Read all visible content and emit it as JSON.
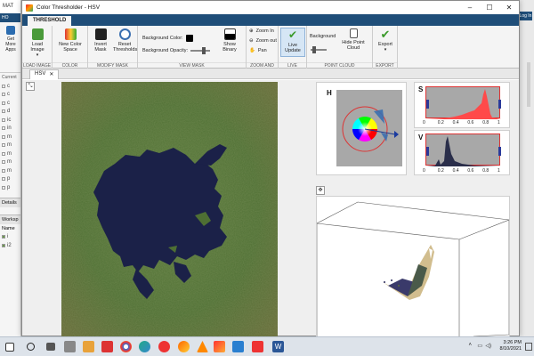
{
  "background_matlab": {
    "title": "MAT",
    "tab": "HO",
    "get_more_apps": "Get More Apps",
    "current_folder_label": "Current",
    "list_items": [
      "c",
      "c",
      "c",
      "d",
      "ic",
      "in",
      "m",
      "m",
      "m",
      "m",
      "m",
      "p",
      "p"
    ],
    "details_label": "Details",
    "workspace_label": "Worksp",
    "name_label": "Name",
    "workspace_vars": [
      "i",
      "i2"
    ],
    "login": "Log In"
  },
  "window": {
    "title": "Color Thresholder - HSV",
    "minimize": "–",
    "maximize": "☐",
    "close": "✕"
  },
  "ribbon": {
    "tab": "THRESHOLD",
    "groups": {
      "load_image": {
        "label": "LOAD IMAGE",
        "button": "Load Image"
      },
      "color_spaces": {
        "label": "COLOR SPACES",
        "button": "New Color Space"
      },
      "modify_mask": {
        "label": "MODIFY MASK",
        "invert": "Invert Mask",
        "reset": "Reset Thresholds"
      },
      "view_mask": {
        "label": "VIEW MASK",
        "bg_color": "Background Color:",
        "bg_opacity": "Background Opacity:",
        "show_binary": "Show Binary"
      },
      "zoom_pan": {
        "label": "ZOOM AND PAN",
        "zoom_in": "Zoom In",
        "zoom_out": "Zoom out",
        "pan": "Pan"
      },
      "live_update": {
        "label": "LIVE UPDATE",
        "button": "Live Update"
      },
      "point_cloud": {
        "label": "POINT CLOUD",
        "background": "Background",
        "hide": "Hide Point Cloud"
      },
      "export": {
        "label": "EXPORT",
        "button": "Export"
      }
    }
  },
  "doc_tab": {
    "label": "HSV",
    "close": "✕"
  },
  "channels": {
    "h": {
      "label": "H"
    },
    "s": {
      "label": "S",
      "ticks": [
        "0",
        "0.2",
        "0.4",
        "0.6",
        "0.8",
        "1"
      ]
    },
    "v": {
      "label": "V",
      "ticks": [
        "0",
        "0.2",
        "0.4",
        "0.6",
        "0.8",
        "1"
      ]
    }
  },
  "taskbar": {
    "time": "3:26 PM",
    "date": "8/10/2021"
  },
  "colors": {
    "ribbon_blue": "#1f4e79",
    "hist_red": "#ff3b3b",
    "hist_dark": "#2a2e4a",
    "lake": "#1b2148"
  }
}
